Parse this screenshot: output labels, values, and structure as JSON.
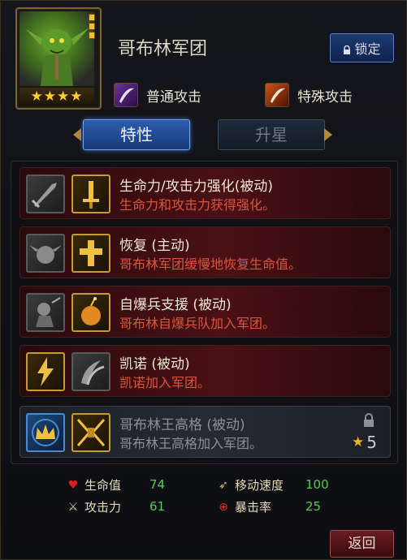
{
  "unit": {
    "name": "哥布林军团",
    "stars": "★★★★",
    "level_bars": 3
  },
  "header": {
    "lock_label": "锁定"
  },
  "attack_types": [
    {
      "label": "普通攻击",
      "icon": "normal-attack-icon"
    },
    {
      "label": "特殊攻击",
      "icon": "special-attack-icon"
    }
  ],
  "tabs": {
    "traits": "特性",
    "star_up": "升星"
  },
  "skills": [
    {
      "name": "生命力/攻击力强化(被动)",
      "desc": "生命力和攻击力获得强化。",
      "icon_a": "sword-icon",
      "icon_b": "golden-sword-icon"
    },
    {
      "name": "恢复 (主动)",
      "desc": "哥布林军团缓慢地恢复生命值。",
      "icon_a": "goblin-face-icon",
      "icon_b": "holy-cross-icon"
    },
    {
      "name": "自爆兵支援 (被动)",
      "desc": "哥布林自爆兵队加入军团。",
      "icon_a": "goblin-bomber-icon",
      "icon_b": "bomb-icon"
    },
    {
      "name": "凯诺 (被动)",
      "desc": "凯诺加入军团。",
      "icon_a": "lightning-icon",
      "icon_b": "claw-icon"
    },
    {
      "name": "哥布林王高格 (被动)",
      "desc": "哥布林王高格加入军团。",
      "icon_a": "crown-icon",
      "icon_b": "goblin-king-icon",
      "locked": true,
      "required_stars": "5"
    }
  ],
  "stats": [
    {
      "label": "生命值",
      "value": "74",
      "icon": "heart-icon"
    },
    {
      "label": "攻击力",
      "value": "61",
      "icon": "sword-stat-icon"
    },
    {
      "label": "移动速度",
      "value": "100",
      "icon": "boot-icon"
    },
    {
      "label": "暴击率",
      "value": "25",
      "icon": "crosshair-icon"
    }
  ],
  "footer": {
    "back_label": "返回"
  },
  "colors": {
    "skill_desc": "#d9563a",
    "stat_value": "#4fd04f",
    "star": "#ffcc33"
  }
}
